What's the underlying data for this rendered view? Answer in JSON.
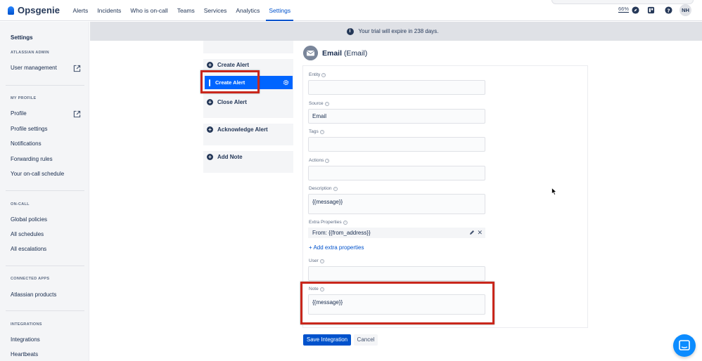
{
  "app": {
    "name": "Opsgenie"
  },
  "topnav": {
    "items": [
      "Alerts",
      "Incidents",
      "Who is on-call",
      "Teams",
      "Services",
      "Analytics",
      "Settings"
    ],
    "active": "Settings",
    "zoom": "66%",
    "avatar_initials": "NH"
  },
  "sidebar": {
    "settings_title": "Settings",
    "sections": {
      "atlassian_admin": "ATLASSIAN ADMIN",
      "my_profile": "MY PROFILE",
      "on_call": "ON-CALL",
      "connected_apps": "CONNECTED APPS",
      "integrations": "INTEGRATIONS"
    },
    "items": {
      "user_management": "User management",
      "profile": "Profile",
      "profile_settings": "Profile settings",
      "notifications": "Notifications",
      "forwarding_rules": "Forwarding rules",
      "on_call_schedule": "Your on-call schedule",
      "global_policies": "Global policies",
      "all_schedules": "All schedules",
      "all_escalations": "All escalations",
      "atlassian_products": "Atlassian products",
      "integrations": "Integrations",
      "heartbeats": "Heartbeats"
    }
  },
  "banner": {
    "text": "Your trial will expire in 238 days."
  },
  "actions": {
    "create_alert_header": "Create Alert",
    "selected": "Create Alert",
    "close_alert": "Close Alert",
    "acknowledge_alert": "Acknowledge Alert",
    "add_note": "Add Note"
  },
  "integration": {
    "name": "Email",
    "type": "(Email)"
  },
  "form": {
    "entity": {
      "label": "Entity",
      "value": ""
    },
    "source": {
      "label": "Source",
      "value": "Email"
    },
    "tags": {
      "label": "Tags",
      "value": ""
    },
    "actions": {
      "label": "Actions",
      "value": ""
    },
    "description": {
      "label": "Description",
      "value": "{{message}}"
    },
    "extra_properties": {
      "label": "Extra Properties",
      "value": "From: {{from_address}}"
    },
    "add_extra": "+ Add extra properties",
    "user": {
      "label": "User",
      "value": ""
    },
    "note": {
      "label": "Note",
      "value": "{{message}}"
    }
  },
  "buttons": {
    "save": "Save Integration",
    "cancel": "Cancel"
  },
  "colors": {
    "primary": "#0052cc",
    "selected": "#0065ff",
    "highlight": "#c9271c"
  }
}
